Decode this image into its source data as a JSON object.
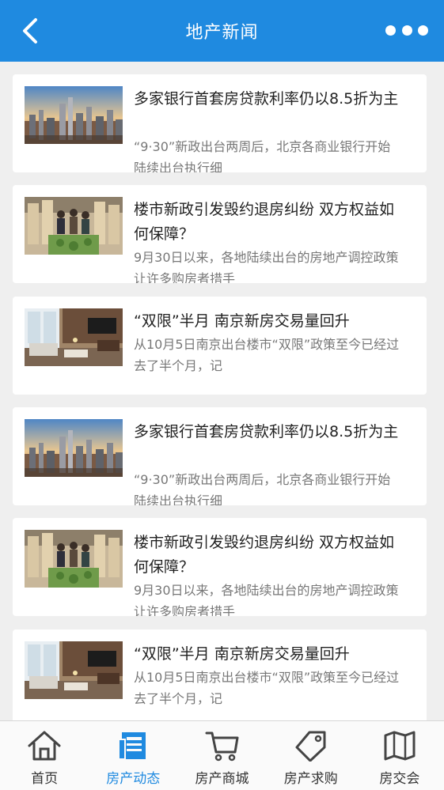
{
  "header": {
    "title": "地产新闻",
    "back_icon": "chevron-left-icon",
    "more_icon": "more-dots-icon",
    "color": "#1f8ae0"
  },
  "news": [
    {
      "image": "city-skyline-thumbnail",
      "title": "多家银行首套房贷款利率仍以8.5折为主",
      "summary": "“9·30”新政出台两周后，北京各商业银行开始陆续出台执行细"
    },
    {
      "image": "property-model-thumbnail",
      "title": "楼市新政引发毁约退房纠纷 双方权益如何保障？",
      "summary": "9月30日以来，各地陆续出台的房地产调控政策让许多购房者措手"
    },
    {
      "image": "living-room-thumbnail",
      "title": "“双限”半月 南京新房交易量回升",
      "summary": "从10月5日南京出台楼市“双限”政策至今已经过去了半个月，记"
    },
    {
      "image": "city-skyline-thumbnail",
      "title": "多家银行首套房贷款利率仍以8.5折为主",
      "summary": "“9·30”新政出台两周后，北京各商业银行开始陆续出台执行细"
    },
    {
      "image": "property-model-thumbnail",
      "title": "楼市新政引发毁约退房纠纷 双方权益如何保障？",
      "summary": "9月30日以来，各地陆续出台的房地产调控政策让许多购房者措手"
    },
    {
      "image": "living-room-thumbnail",
      "title": "“双限”半月 南京新房交易量回升",
      "summary": "从10月5日南京出台楼市“双限”政策至今已经过去了半个月，记"
    }
  ],
  "tabbar": {
    "active": "房产动态",
    "active_color": "#1f8ae0",
    "items": [
      {
        "label": "首页",
        "icon": "home-icon"
      },
      {
        "label": "房产动态",
        "icon": "news-icon"
      },
      {
        "label": "房产商城",
        "icon": "cart-icon"
      },
      {
        "label": "房产求购",
        "icon": "tag-icon"
      },
      {
        "label": "房交会",
        "icon": "map-icon"
      }
    ]
  }
}
